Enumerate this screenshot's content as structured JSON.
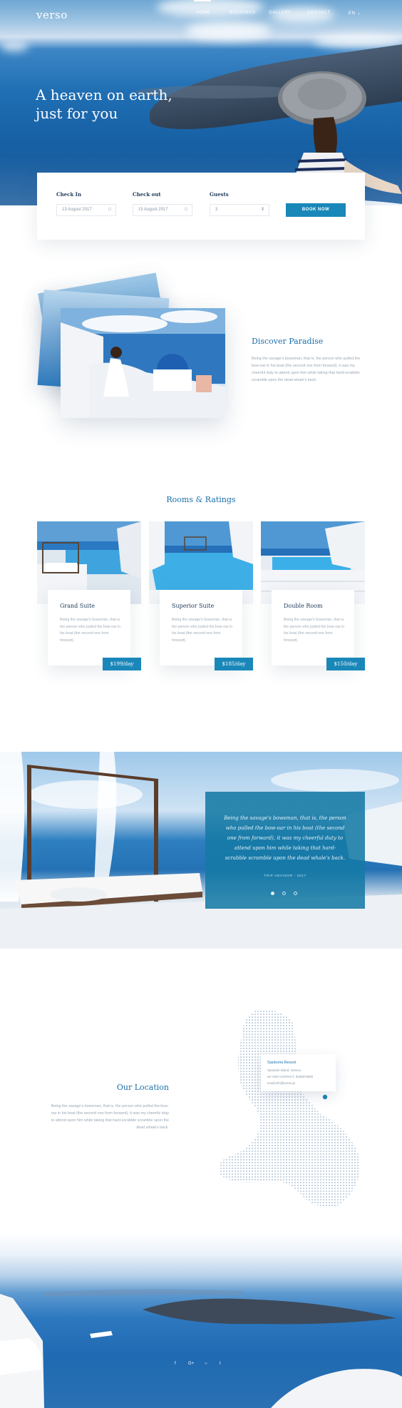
{
  "brand": {
    "logo": "verso"
  },
  "nav": {
    "items": [
      "HOME",
      "BOOKINGS",
      "GALLERY",
      "CONTACT",
      "EN"
    ],
    "active": "HOME"
  },
  "hero": {
    "title_line1": "A heaven on earth,",
    "title_line2": "just for you"
  },
  "booking": {
    "checkin_label": "Check In",
    "checkin_value": "13 August 2017",
    "checkout_label": "Check out",
    "checkout_value": "15 August 2017",
    "guests_label": "Guests",
    "guests_value": "3",
    "button_label": "BOOK NOW"
  },
  "discover": {
    "title": "Discover Paradise",
    "text": "Being the savage's bowsman, that is, the person who pulled the bow-oar in his boat (the second one from forward), it was my cheerful duty to attend upon him while taking that hard-scrabble scramble upon the dead whale's back."
  },
  "rooms": {
    "title": "Rooms & Ratings",
    "items": [
      {
        "name": "Grand Suite",
        "desc": "Being the savage's bowsman, that is, the person who pulled the bow-oar in his boat (the second one from forward).",
        "price": "$199/day"
      },
      {
        "name": "Superior Suite",
        "desc": "Being the savage's bowsman, that is, the person who pulled the bow-oar in his boat (the second one from forward).",
        "price": "$185/day"
      },
      {
        "name": "Double Room",
        "desc": "Being the savage's bowsman, that is, the person who pulled the bow-oar in his boat (the second one from forward).",
        "price": "$150/day"
      }
    ]
  },
  "testimonial": {
    "quote": "Being the savage's bowsman, that is, the person who pulled the bow-oar in his boat (the second one from forward), it was my cheerful duty to attend upon him while taking that hard-scrabble scramble upon the dead whale's back.",
    "author": "TRIP ADVISOR - 2017",
    "slides": 3,
    "active_slide": 1
  },
  "location": {
    "title": "Our Location",
    "text": "Being the savage's bowsman, that is, the person who pulled the bow-oar in his boat (the second one from forward), it was my cheerful duty to attend upon him while taking that hard-scrabble scramble upon the dead whale's back.",
    "card": {
      "name": "Santorini Resort",
      "line1": "Santorini Island, Greece",
      "line2": "tel:+030 CONTACT, 0030676000",
      "line3": "email:info@verso.gr"
    }
  },
  "footer": {
    "social": [
      "f",
      "G+",
      "○",
      "t"
    ]
  },
  "colors": {
    "accent": "#1a87b9",
    "heading": "#1a6fa8",
    "text": "#9aa7b5"
  }
}
